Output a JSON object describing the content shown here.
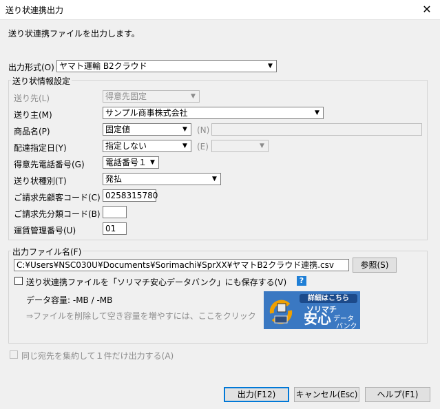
{
  "window": {
    "title": "送り状連携出力",
    "close_glyph": "✕"
  },
  "intro": "送り状連携ファイルを出力します。",
  "output_format": {
    "label": "出力形式(O)",
    "value": "ヤマト運輸  B2クラウド"
  },
  "invoice_settings": {
    "group_label": "送り状情報設定",
    "destination": {
      "label": "送り先(L)",
      "value": "得意先固定"
    },
    "sender": {
      "label": "送り主(M)",
      "value": "サンプル商事株式会社"
    },
    "product_name": {
      "label": "商品名(P)",
      "value": "固定値",
      "n_label": "(N)",
      "n_value": ""
    },
    "delivery_date": {
      "label": "配達指定日(Y)",
      "value": "指定しない",
      "e_label": "(E)",
      "e_value": ""
    },
    "customer_phone": {
      "label": "得意先電話番号(G)",
      "value": "電話番号１"
    },
    "invoice_type": {
      "label": "送り状種別(T)",
      "value": "発払"
    },
    "billing_code": {
      "label": "ご請求先顧客コード(C)",
      "value": "0258315780"
    },
    "billing_class": {
      "label": "ご請求先分類コード(B)",
      "value": ""
    },
    "freight_number": {
      "label": "運賃管理番号(U)",
      "value": "01"
    }
  },
  "output_file": {
    "group_label": "出力ファイル名(F)",
    "path": "C:¥Users¥NSC030U¥Documents¥Sorimachi¥SprXX¥ヤマトB2クラウド連携.csv",
    "browse_label": "参照(S)",
    "save_check_label": "送り状連携ファイルを「ソリマチ安心データバンク」にも保存する(V)",
    "save_checked": false,
    "capacity_text": "データ容量:  -MB / -MB",
    "delete_hint": "⇒ファイルを削除して空き容量を増やすには、ここをクリック",
    "banner": {
      "top": "詳細はこちら",
      "brand": "ソリマチ",
      "big": "安心",
      "small1": "データ",
      "small2": "バンク"
    }
  },
  "aggregate": {
    "label": "同じ宛先を集約して１件だけ出力する(A)",
    "checked": false
  },
  "buttons": {
    "output": "出力(F12)",
    "cancel": "キャンセル(Esc)",
    "help": "ヘルプ(F1)"
  },
  "icons": {
    "dropdown_arrow": "▼",
    "help": "?"
  }
}
